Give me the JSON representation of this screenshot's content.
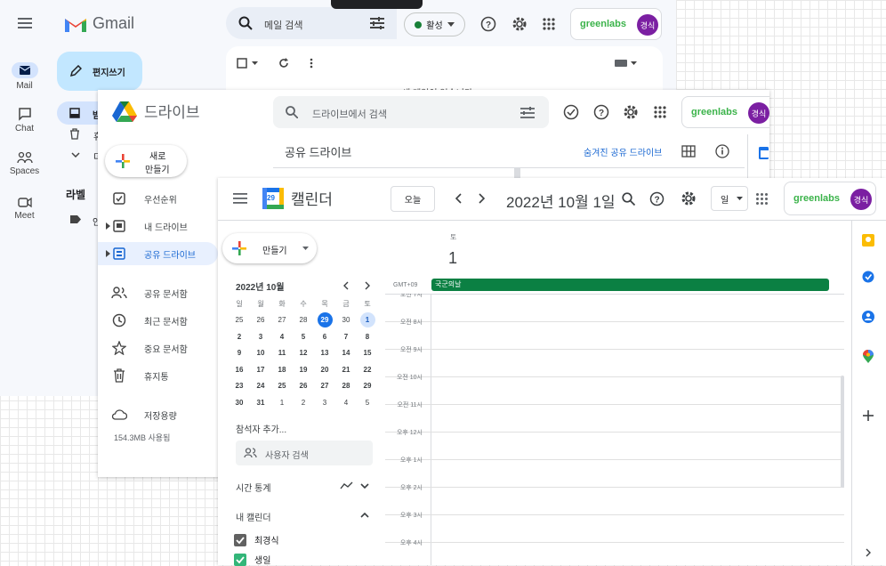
{
  "gmail": {
    "logo": "Gmail",
    "search_placeholder": "메일 검색",
    "status": "활성",
    "compose": "편지쓰기",
    "rail": [
      {
        "label": "Mail"
      },
      {
        "label": "Chat"
      },
      {
        "label": "Spaces"
      },
      {
        "label": "Meet"
      }
    ],
    "labels_heading": "라벨",
    "empty_text": "새 메일이 없습니다",
    "nav_partial": [
      "받",
      "휴",
      "더",
      "안"
    ],
    "brand": "greenlabs",
    "avatar": "경식"
  },
  "drive": {
    "logo": "드라이브",
    "search_placeholder": "드라이브에서 검색",
    "new_button": [
      "새로",
      "만들기"
    ],
    "nav": [
      {
        "label": "우선순위",
        "icon": "check-box-icon"
      },
      {
        "label": "내 드라이브",
        "icon": "my-drive-icon"
      },
      {
        "label": "공유 드라이브",
        "icon": "shared-drives-icon",
        "active": true
      },
      {
        "label": "공유 문서함",
        "icon": "people-icon"
      },
      {
        "label": "최근 문서함",
        "icon": "clock-icon"
      },
      {
        "label": "중요 문서함",
        "icon": "star-icon"
      },
      {
        "label": "휴지통",
        "icon": "trash-icon"
      },
      {
        "label": "저장용량",
        "icon": "cloud-icon"
      }
    ],
    "storage_used": "154.3MB 사용됨",
    "header": "공유 드라이브",
    "hidden_link": "숨겨진 공유 드라이브",
    "brand": "greenlabs",
    "avatar": "경식"
  },
  "calendar": {
    "logo": "캘린더",
    "logo_day": "29",
    "today_button": "오늘",
    "title": "2022년 10월 1일",
    "view": "일",
    "create": "만들기",
    "brand": "greenlabs",
    "avatar": "경식",
    "mini": {
      "title": "2022년 10월",
      "weekdays": [
        "일",
        "월",
        "화",
        "수",
        "목",
        "금",
        "토"
      ],
      "weeks": [
        [
          "25",
          "26",
          "27",
          "28",
          "29",
          "30",
          "1"
        ],
        [
          "2",
          "3",
          "4",
          "5",
          "6",
          "7",
          "8"
        ],
        [
          "9",
          "10",
          "11",
          "12",
          "13",
          "14",
          "15"
        ],
        [
          "16",
          "17",
          "18",
          "19",
          "20",
          "21",
          "22"
        ],
        [
          "23",
          "24",
          "25",
          "26",
          "27",
          "28",
          "29"
        ],
        [
          "30",
          "31",
          "1",
          "2",
          "3",
          "4",
          "5"
        ]
      ]
    },
    "guests_title": "참석자 추가...",
    "guest_search": "사용자 검색",
    "time_stats": "시간 통계",
    "my_cal": "내 캘린더",
    "calendars": [
      {
        "name": "최경식",
        "color": "#616161"
      },
      {
        "name": "생일",
        "color": "#33b679"
      }
    ],
    "day_name": "토",
    "day_num": "1",
    "tz": "GMT+09",
    "event": "국군의날",
    "event_color": "#0b8043",
    "times": [
      "오전 7시",
      "오전 8시",
      "오전 9시",
      "오전 10시",
      "오전 11시",
      "오후 12시",
      "오후 1시",
      "오후 2시",
      "오후 3시",
      "오후 4시"
    ],
    "today_color": "#1a73e8"
  }
}
